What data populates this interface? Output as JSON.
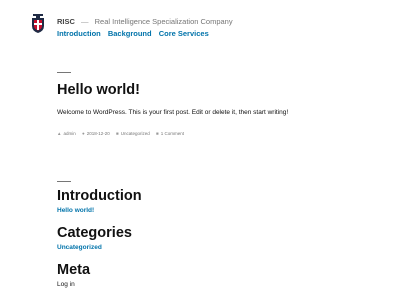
{
  "site": {
    "title": "RISC",
    "separator": "—",
    "description": "Real Intelligence Specialization Company"
  },
  "nav": {
    "items": [
      {
        "label": "Introduction"
      },
      {
        "label": "Background"
      },
      {
        "label": "Core Services"
      }
    ]
  },
  "post": {
    "title": "Hello world!",
    "content": "Welcome to WordPress. This is your first post. Edit or delete it, then start writing!",
    "meta": {
      "author": "admin",
      "date": "2018-12-20",
      "category": "Uncategorized",
      "comments": "1 Comment"
    }
  },
  "widgets": [
    {
      "title": "Introduction",
      "link": "Hello world!"
    },
    {
      "title": "Categories",
      "link": "Uncategorized"
    },
    {
      "title": "Meta",
      "link": "Log in"
    }
  ],
  "colors": {
    "link": "#0073aa",
    "text": "#111111",
    "muted": "#767676",
    "logo_red": "#c8102e",
    "logo_navy": "#1f2a44"
  }
}
